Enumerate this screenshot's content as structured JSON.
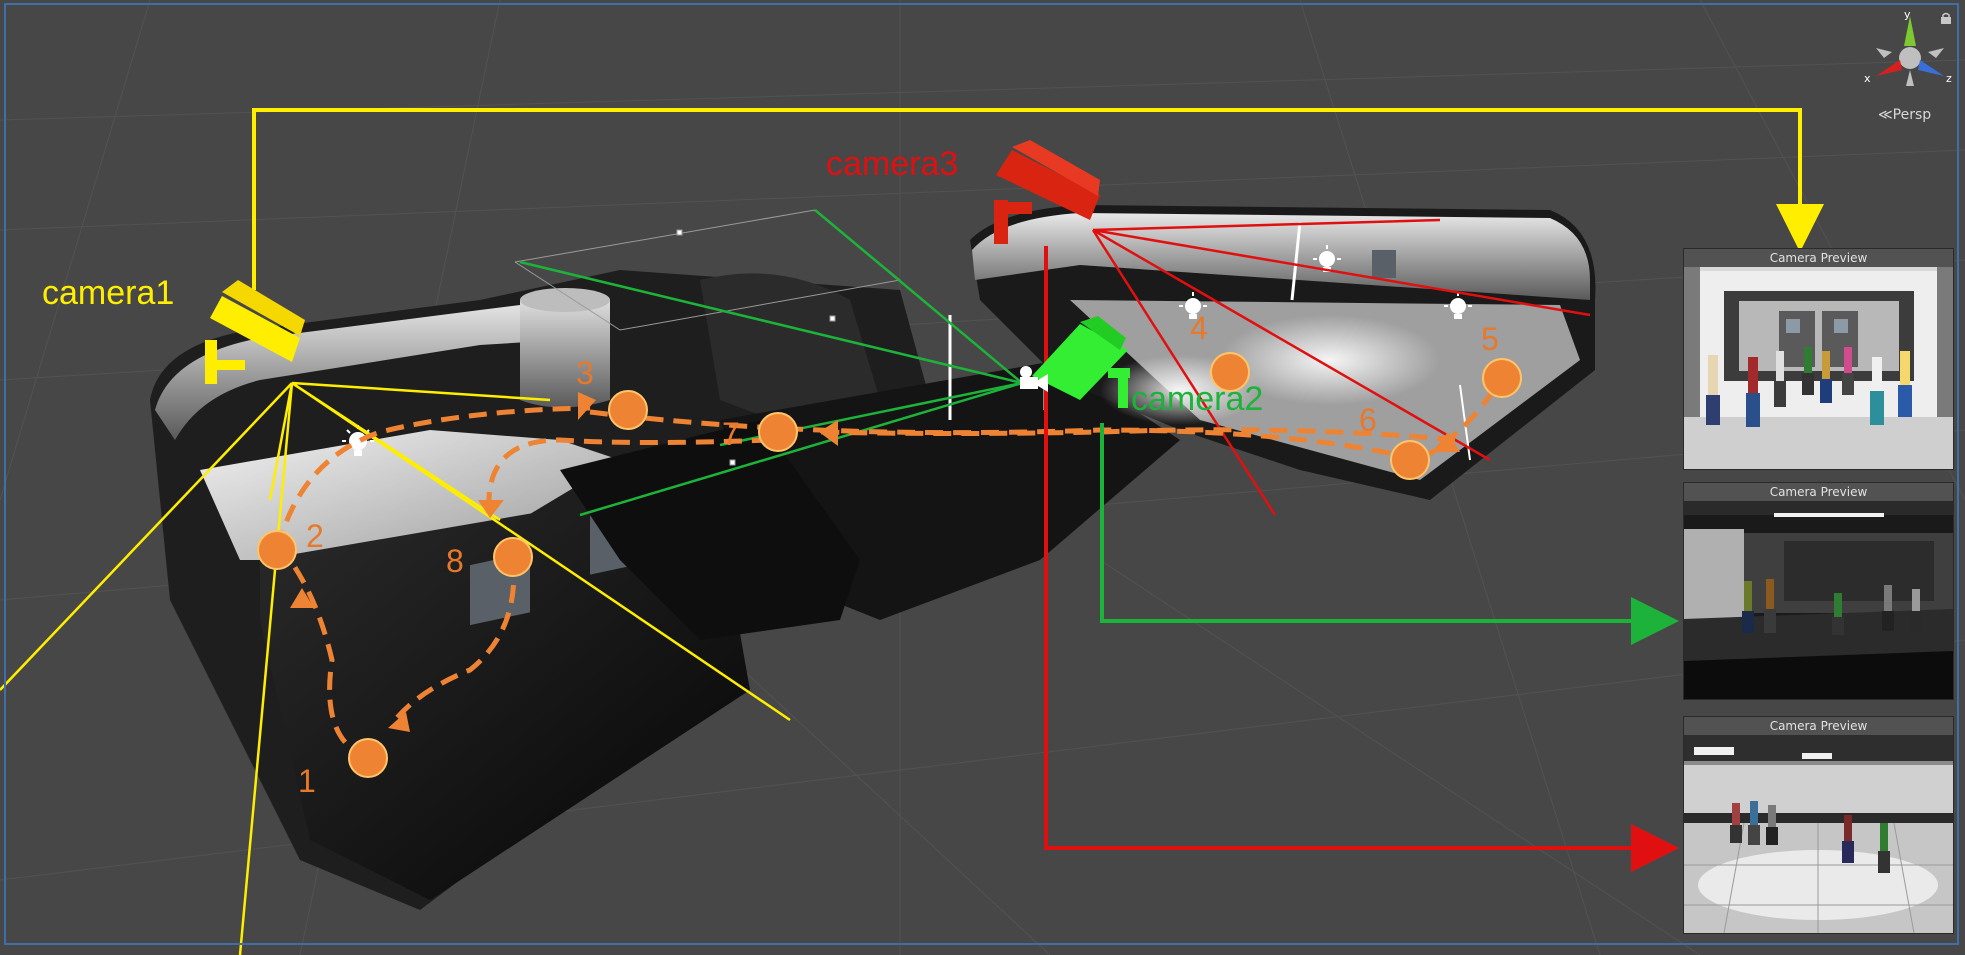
{
  "scene_view": {
    "projection_label": "Persp",
    "axis_labels": {
      "x": "x",
      "y": "y",
      "z": "z"
    }
  },
  "cameras": [
    {
      "id": "camera1",
      "label": "camera1",
      "color": "#ffee00"
    },
    {
      "id": "camera2",
      "label": "camera2",
      "color": "#1db33a"
    },
    {
      "id": "camera3",
      "label": "camera3",
      "color": "#e01010"
    }
  ],
  "waypoints": [
    "1",
    "2",
    "3",
    "4",
    "5",
    "6",
    "7",
    "8"
  ],
  "path_color": "#ee8433",
  "previews": [
    {
      "title": "Camera Preview",
      "source": "camera1"
    },
    {
      "title": "Camera Preview",
      "source": "camera2"
    },
    {
      "title": "Camera Preview",
      "source": "camera3"
    }
  ]
}
